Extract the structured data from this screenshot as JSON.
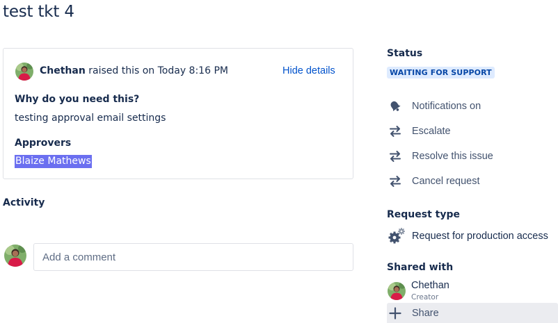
{
  "page": {
    "title": "test tkt 4"
  },
  "request": {
    "author": "Chethan",
    "raised_text": " raised this on Today 8:16 PM",
    "hide_details": "Hide details",
    "fields": [
      {
        "label": "Why do you need this?",
        "value": "testing approval email settings"
      },
      {
        "label": "Approvers",
        "value": "Blaize Mathews"
      }
    ]
  },
  "activity": {
    "title": "Activity",
    "comment_placeholder": "Add a comment"
  },
  "sidebar": {
    "status_heading": "Status",
    "status_badge": "WAITING FOR SUPPORT",
    "actions": [
      {
        "label": "Notifications on",
        "icon": "bell-icon"
      },
      {
        "label": "Escalate",
        "icon": "transition-arrows-icon"
      },
      {
        "label": "Resolve this issue",
        "icon": "transition-arrows-icon"
      },
      {
        "label": "Cancel request",
        "icon": "transition-arrows-icon"
      }
    ],
    "request_type_heading": "Request type",
    "request_type": {
      "label": "Request for production access",
      "icon": "gears-icon"
    },
    "shared_with_heading": "Shared with",
    "shared_with": [
      {
        "name": "Chethan",
        "role": "Creator"
      }
    ],
    "share_label": "Share"
  },
  "colors": {
    "link": "#0052cc",
    "status_bg": "#deebff",
    "status_text": "#0747a6",
    "selection": "#6b6ff0",
    "share_bg": "#ebecf0"
  }
}
